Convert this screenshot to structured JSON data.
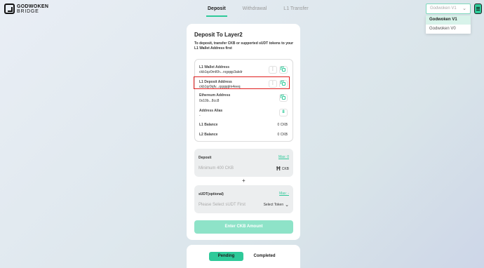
{
  "header": {
    "logo_line1": "GODWOKEN",
    "logo_line2": "BRIDGE",
    "nav": [
      "Deposit",
      "Withdrawal",
      "L1 Transfer"
    ],
    "version_selected": "Godwoken V1",
    "version_options": [
      "Godwoken V1",
      "Godwoken V0"
    ]
  },
  "deposit_card": {
    "title": "Deposit To Layer2",
    "description": "To deposit, transfer CKB or supported sUDT tokens to your L1 Wallet Address first",
    "l1_wallet_label": "L1 Wallet Address",
    "l1_wallet_value": "ckb1qz0rnl6h...rxgqqp3akdr",
    "l1_deposit_label": "L1 Deposit Address",
    "l1_deposit_value": "ckb1qr9qfv...qqqqqlm4eeq",
    "eth_label": "Ethereum Address",
    "eth_value": "0x10b...8cc8",
    "alias_label": "Address Alias",
    "alias_value": "-",
    "l1_balance_label": "L1 Balance",
    "l1_balance_value": "0 CKB",
    "l2_balance_label": "L2 Balance",
    "l2_balance_value": "0 CKB",
    "deposit_label": "Deposit",
    "deposit_max": "Max: 0",
    "deposit_placeholder": "Minimum 400 CKB",
    "deposit_token": "CKB",
    "plus": "+",
    "sudt_label": "sUDT(optional)",
    "sudt_max": "Max: -",
    "sudt_placeholder": "Please Select sUDT First",
    "sudt_select": "Select Token",
    "submit_label": "Enter CKB Amount"
  },
  "history": {
    "tab_pending": "Pending",
    "tab_completed": "Completed"
  },
  "colors": {
    "accent": "#2ec999",
    "highlight": "#e01f1f"
  }
}
